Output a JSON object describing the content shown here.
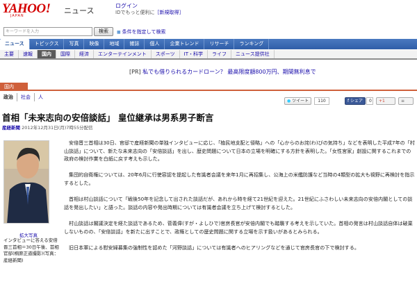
{
  "header": {
    "logo": "YAHOO!",
    "logo_sub": "JAPAN",
    "section": "ニュース",
    "login": "ログイン",
    "login_note": "IDでもっと便利に",
    "register": "［新規取得］"
  },
  "search": {
    "placeholder": "キーワードを入力",
    "button": "検索",
    "options": "条件を指定して検索"
  },
  "tabs": [
    "ニュース",
    "トピックス",
    "写真",
    "映像",
    "地域",
    "雑誌",
    "個人",
    "企業トレンド",
    "リサーチ",
    "ランキング"
  ],
  "subtabs": [
    "主要",
    "速報",
    "国内",
    "国際",
    "経済",
    "エンターテインメント",
    "スポーツ",
    "IT・科学",
    "ライフ",
    "ニュース提供社"
  ],
  "pr": {
    "tag": "[PR]",
    "text": "私でも借りられるカードローン？ 最高限度額800万円、期間無利息で"
  },
  "category": "国内",
  "crumbs": [
    "政治",
    "社会",
    "人"
  ],
  "share": {
    "tweet": "ツイート",
    "tweet_count": "110",
    "fb": "シェア",
    "fb_count": "0"
  },
  "article": {
    "title": "首相「未来志向の安倍談話」 皇位継承は男系男子断言",
    "source": "産経新聞",
    "date": "2012年12月31日(月)7時55分配信",
    "enlarge": "拡大写真",
    "caption": "インタビューに答える安倍晋三首相＝30日午後、首相官邸(桐原正道撮影)(写真：産経新聞)",
    "p1": "安倍晋三首相は30日、官邸で産経新聞の単独インタビューに応じ、「植民地支配と侵略」への「心からのお詫(わ)びの気持ち」などを表明した平成7年の「村山談話」について、新たな未来志向の「安倍談話」を出し、歴史問題について日本の立場を明確にする方針を表明した。「女性宮家」創設に関するこれまでの政府の検討作業を白紙に戻す考えも示した。",
    "p2": "集団的自衛権については、20年6月に行使容認を提起した有識者会議を来年1月に再招集し、公海上の米艦防護など当時の4類型の拡大も視野に再検討を指示するとした。",
    "p3": "首相は村山談話について「戦後50年を記念して出された談話だが、あれから時を経て21世紀を迎えた。21世紀にふさわしい未来志向の安倍内閣としての談話を発出したい」と語った。談話の内容や発出時期については有識者会議を立ち上げて検討するとした。",
    "p4": "村山談話は閣議決定を経た談話であるため、菅義偉(すが・よしひで)官房長官が安倍内閣でも踏襲する考えを示していた。首相の発言は村山談話自体は破棄しないものの、「安倍談話」を新たに出すことで、政権としての歴史問題に関する立場を示す扱いがあるとみられる。",
    "p5": "旧日本軍による慰安婦募集の強制性を認めた「河野談話」については有識者へのヒアリングなどを通じて官房長官の下で検討する。"
  },
  "colors": {
    "logo_red": "#d40000",
    "nav_blue": "#2f5ea8",
    "category_orange": "#cf5f3a",
    "link_blue": "#1a0dab"
  }
}
